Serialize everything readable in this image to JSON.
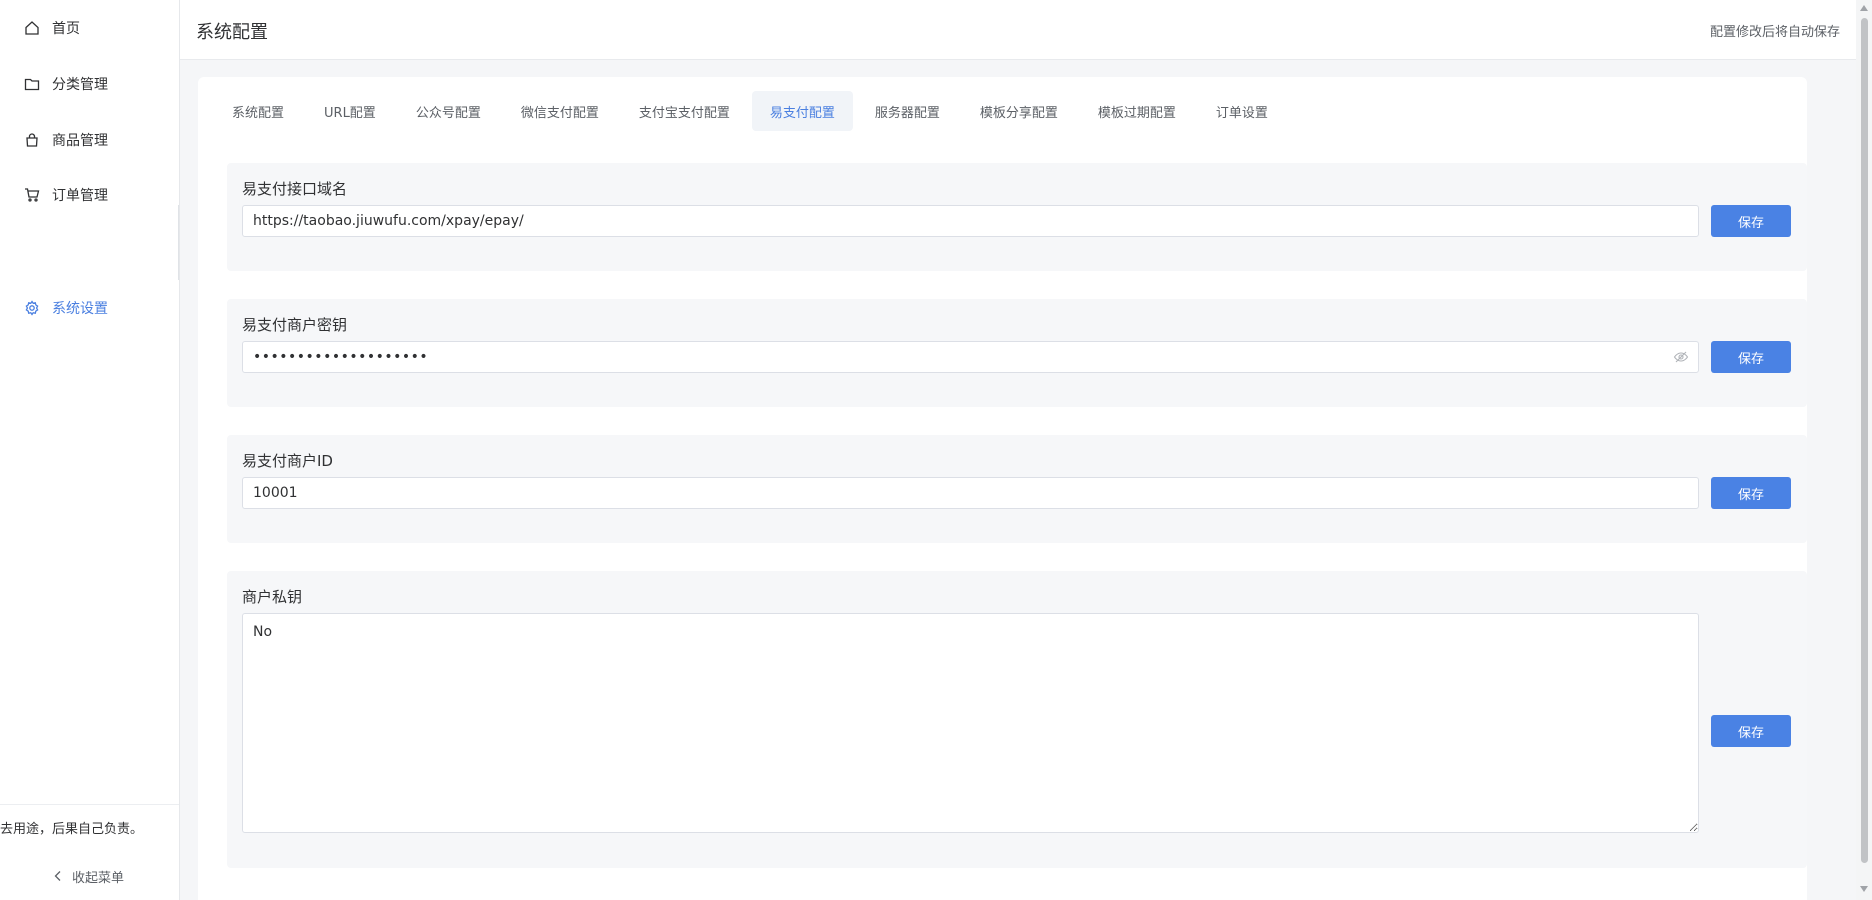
{
  "sidebar": {
    "items": [
      {
        "label": "首页",
        "icon": "home-icon"
      },
      {
        "label": "分类管理",
        "icon": "folder-icon"
      },
      {
        "label": "商品管理",
        "icon": "bag-icon"
      },
      {
        "label": "订单管理",
        "icon": "cart-icon"
      },
      {
        "label": "系统设置",
        "icon": "gear-icon",
        "active": true
      }
    ],
    "notice": "去用途，后果自己负责。",
    "collapse_label": "收起菜单"
  },
  "header": {
    "title": "系统配置",
    "autosave_note": "配置修改后将自动保存"
  },
  "tabs": [
    {
      "label": "系统配置"
    },
    {
      "label": "URL配置"
    },
    {
      "label": "公众号配置"
    },
    {
      "label": "微信支付配置"
    },
    {
      "label": "支付宝支付配置"
    },
    {
      "label": "易支付配置",
      "active": true
    },
    {
      "label": "服务器配置"
    },
    {
      "label": "模板分享配置"
    },
    {
      "label": "模板过期配置"
    },
    {
      "label": "订单设置"
    }
  ],
  "form": {
    "api_domain": {
      "label": "易支付接口域名",
      "value": "https://taobao.jiuwufu.com/xpay/epay/"
    },
    "merchant_key": {
      "label": "易支付商户密钥",
      "value": "••••••••••••••••••••"
    },
    "merchant_id": {
      "label": "易支付商户ID",
      "value": "10001"
    },
    "private_key": {
      "label": "商户私钥",
      "value": "No"
    },
    "save_label": "保存"
  },
  "colors": {
    "accent": "#4a82e4",
    "active_text": "#4a7fe0",
    "section_bg": "#f6f7f9"
  }
}
